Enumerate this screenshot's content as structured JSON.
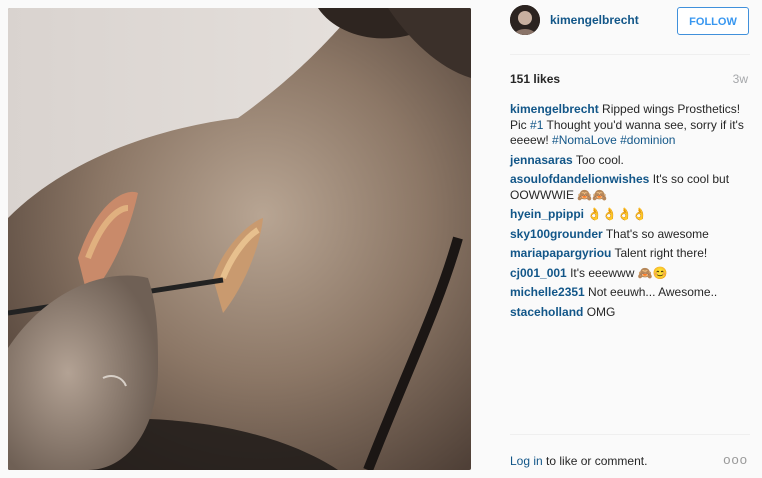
{
  "post": {
    "photo_icon": "post-photo"
  },
  "header": {
    "username": "kimengelbrecht",
    "follow_label": "FOLLOW"
  },
  "meta": {
    "likes": "151 likes",
    "age": "3w"
  },
  "caption": {
    "user": "kimengelbrecht",
    "text1": " Ripped wings Prosthetics! Pic ",
    "tag1": "#1",
    "text2": " Thought you'd wanna see, sorry if it's eeeew! ",
    "tag2": "#NomaLove",
    "text3": " ",
    "tag3": "#dominion"
  },
  "comments": [
    {
      "user": "jennasaras",
      "text": " Too cool."
    },
    {
      "user": "asoulofdandelionwishes",
      "text": " It's so cool but OOWWWIE 🙈🙈"
    },
    {
      "user": "hyein_ppippi",
      "text": " 👌👌👌👌"
    },
    {
      "user": "sky100grounder",
      "text": " That's so awesome"
    },
    {
      "user": "mariapapargyriou",
      "text": " Talent right there!"
    },
    {
      "user": "cj001_001",
      "text": " It's eeewww 🙈😊"
    },
    {
      "user": "michelle2351",
      "text": " Not eeuwh... Awesome.."
    },
    {
      "user": "staceholland",
      "text": " OMG"
    }
  ],
  "footer": {
    "login_link": "Log in",
    "login_text": " to like or comment.",
    "more_icon": "ellipsis-icon",
    "more_label": "ooo"
  },
  "colors": {
    "link": "#125688",
    "follow_border": "#4090db",
    "follow_text": "#3897f0"
  }
}
